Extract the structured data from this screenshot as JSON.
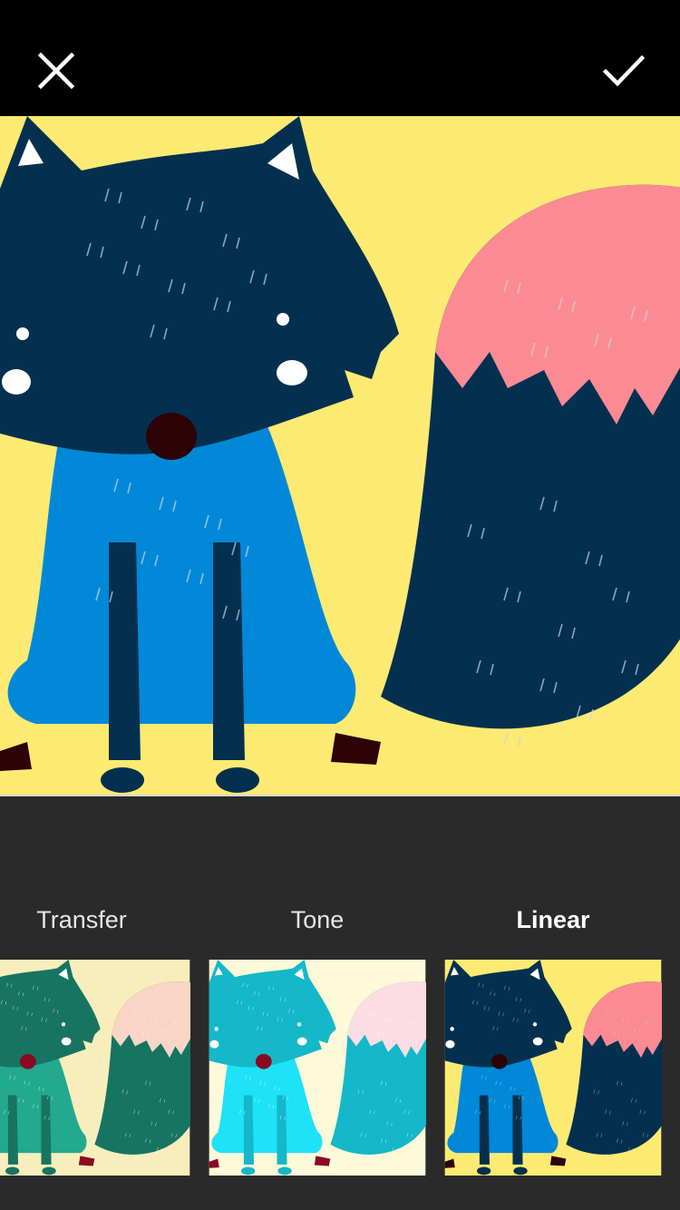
{
  "header": {
    "close_icon": "close-icon",
    "done_icon": "checkmark-icon"
  },
  "filters": {
    "items": [
      {
        "label": "Transfer",
        "selected": false,
        "palette": "transfer"
      },
      {
        "label": "Tone",
        "selected": false,
        "palette": "tone"
      },
      {
        "label": "Linear",
        "selected": true,
        "palette": "linear"
      }
    ]
  },
  "colors": {
    "top_bar": "#000000",
    "panel": "#2a2a2a",
    "label": "#e6e6e6",
    "label_selected": "#ffffff",
    "linear": {
      "bg": "#fdea72",
      "body": "#0288d8",
      "dark": "#04304f",
      "tail_tip": "#fb8a93",
      "nose": "#2c0306"
    },
    "tone": {
      "bg": "#fef9d8",
      "body": "#1ee2f8",
      "dark": "#14b8c8",
      "tail_tip": "#fddde4",
      "nose": "#8a0a22"
    },
    "transfer": {
      "bg": "#f8eebc",
      "body": "#22a98f",
      "dark": "#177461",
      "tail_tip": "#f9d5c5",
      "nose": "#8a0a22"
    }
  }
}
